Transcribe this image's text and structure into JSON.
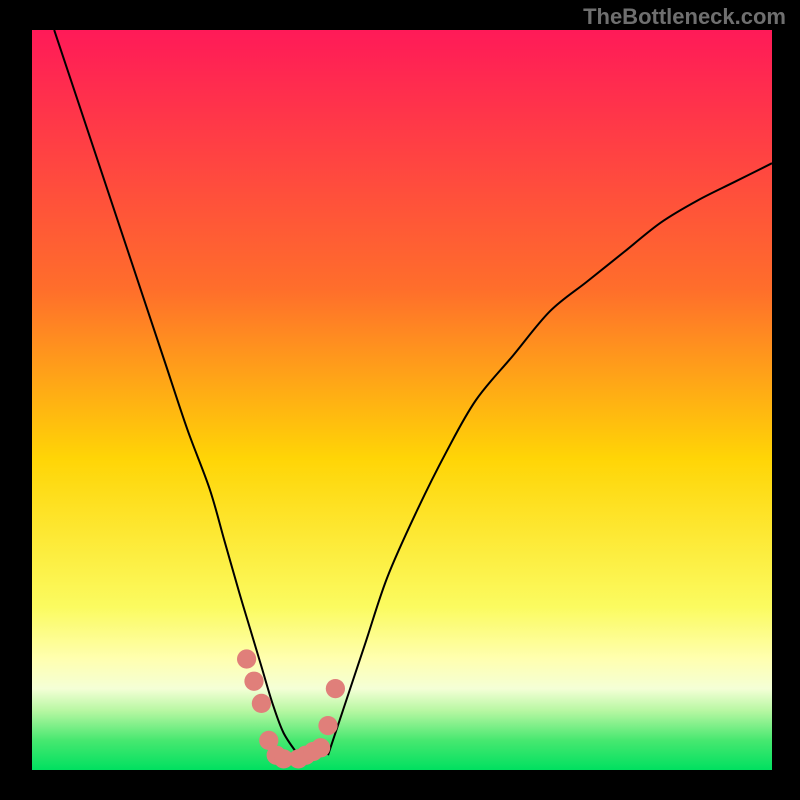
{
  "watermark": "TheBottleneck.com",
  "chart_data": {
    "type": "line",
    "title": "",
    "xlabel": "",
    "ylabel": "",
    "xlim": [
      0,
      100
    ],
    "ylim": [
      0,
      100
    ],
    "background_gradient": {
      "stops": [
        {
          "offset": 0,
          "color": "#ff1a58"
        },
        {
          "offset": 35,
          "color": "#ff6e2b"
        },
        {
          "offset": 58,
          "color": "#ffd506"
        },
        {
          "offset": 78,
          "color": "#fbfb60"
        },
        {
          "offset": 85,
          "color": "#ffffb0"
        },
        {
          "offset": 89,
          "color": "#f4ffd6"
        },
        {
          "offset": 92,
          "color": "#b7f7a2"
        },
        {
          "offset": 96,
          "color": "#47e870"
        },
        {
          "offset": 100,
          "color": "#00e060"
        }
      ]
    },
    "series": [
      {
        "name": "left-arm",
        "stroke": "#000000",
        "type": "line",
        "x": [
          3,
          6,
          9,
          12,
          15,
          18,
          21,
          24,
          26,
          28,
          29.5,
          31,
          32.5,
          34,
          36
        ],
        "y": [
          100,
          91,
          82,
          73,
          64,
          55,
          46,
          38,
          31,
          24,
          19,
          14,
          9,
          5,
          2
        ]
      },
      {
        "name": "right-arm",
        "stroke": "#000000",
        "type": "line",
        "x": [
          40,
          42,
          45,
          48,
          52,
          56,
          60,
          65,
          70,
          75,
          80,
          85,
          90,
          95,
          100
        ],
        "y": [
          2,
          8,
          17,
          26,
          35,
          43,
          50,
          56,
          62,
          66,
          70,
          74,
          77,
          79.5,
          82
        ]
      },
      {
        "name": "bottom-markers",
        "stroke": "#e07f7a",
        "type": "scatter",
        "x": [
          29,
          30,
          31,
          32,
          33,
          34,
          36,
          37,
          38,
          39,
          40,
          41
        ],
        "y": [
          15,
          12,
          9,
          4,
          2,
          1.5,
          1.5,
          2,
          2.5,
          3,
          6,
          11
        ]
      }
    ]
  }
}
